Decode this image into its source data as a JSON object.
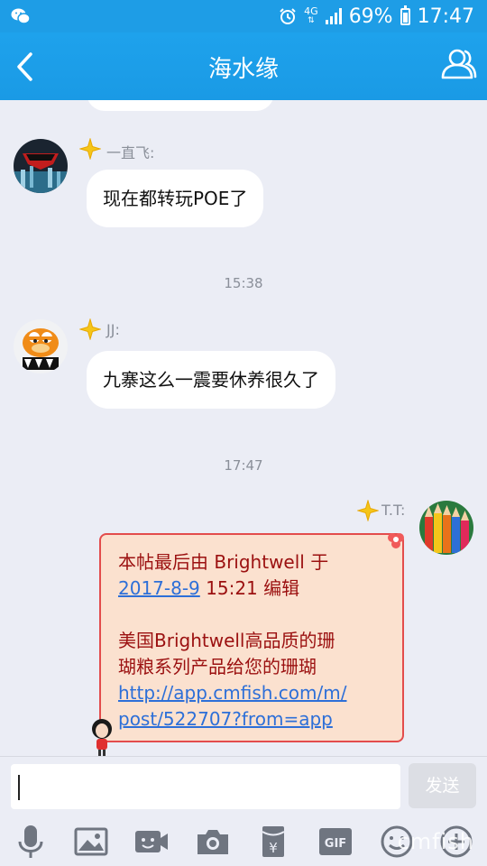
{
  "status_bar": {
    "network": "4G",
    "battery_percent": "69%",
    "time": "17:47",
    "icons": [
      "wechat-icon",
      "alarm-icon",
      "4g-icon",
      "signal-icon",
      "battery-icon"
    ]
  },
  "header": {
    "title": "海水缘",
    "back_icon": "chevron-left-icon",
    "profile_icon": "group-profile-icon"
  },
  "messages": [
    {
      "sender": "一直飞:",
      "text": "现在都转玩POE了"
    },
    {
      "time": "15:38",
      "sender": "JJ:",
      "text": "九寨这么一震要休养很久了"
    },
    {
      "time": "17:47",
      "sender": "T.T:",
      "card_lines": [
        {
          "text": " 本帖最后由 Brightwell 于 ",
          "link": null
        },
        {
          "link": "2017-8-9",
          "text": " 15:21 编辑"
        },
        {
          "text": "",
          "link": null
        },
        {
          "text": "美国Brightwell高品质的珊",
          "link": null
        },
        {
          "text": "瑚粮系列产品给您的珊瑚",
          "link": null
        },
        {
          "text": "",
          "link": "http://app.cmfish.com/m/"
        },
        {
          "text": "",
          "link": "post/522707?from=app"
        }
      ]
    }
  ],
  "input": {
    "placeholder": "",
    "value": "",
    "send_label": "发送"
  },
  "toolbar": {
    "items": [
      "microphone-icon",
      "image-icon",
      "video-call-icon",
      "camera-icon",
      "red-packet-icon",
      "gif-icon",
      "emoji-icon",
      "plus-icon"
    ],
    "gif_label": "GIF",
    "yuan_label": "¥"
  },
  "watermark": "cmfish"
}
